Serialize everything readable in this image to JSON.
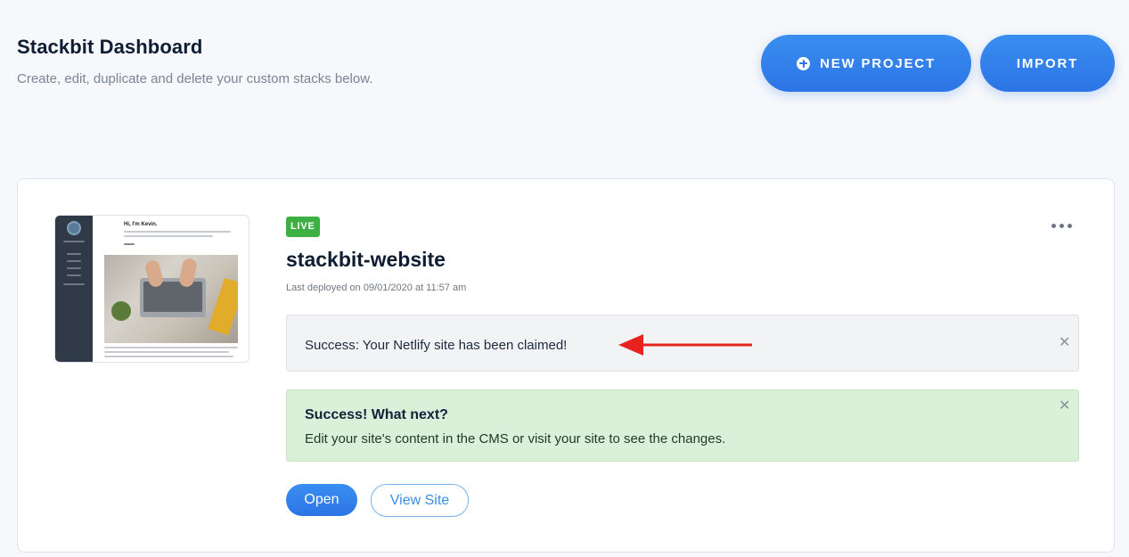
{
  "header": {
    "title": "Stackbit Dashboard",
    "subtitle": "Create, edit, duplicate and delete your custom stacks below."
  },
  "actions": {
    "new_project_label": "NEW PROJECT",
    "import_label": "IMPORT"
  },
  "project": {
    "status_badge": "LIVE",
    "name": "stackbit-website",
    "last_deployed": "Last deployed on 09/01/2020 at 11:57 am",
    "thumbnail_heading": "Hi, I'm Kevin.",
    "alerts": {
      "claimed": "Success: Your Netlify site has been claimed!",
      "next_title": "Success! What next?",
      "next_text": "Edit your site's content in the CMS or visit your site to see the changes."
    },
    "buttons": {
      "open_label": "Open",
      "view_site_label": "View Site"
    }
  },
  "colors": {
    "primary": "#2c74e6",
    "live_badge": "#3cb043",
    "success_bg": "#daf0d8",
    "annotation_arrow": "#e8231f"
  },
  "icons": {
    "new_project": "plus-circle-icon",
    "more": "more-horizontal-icon",
    "close": "close-icon",
    "annotation": "arrow-left-icon"
  }
}
